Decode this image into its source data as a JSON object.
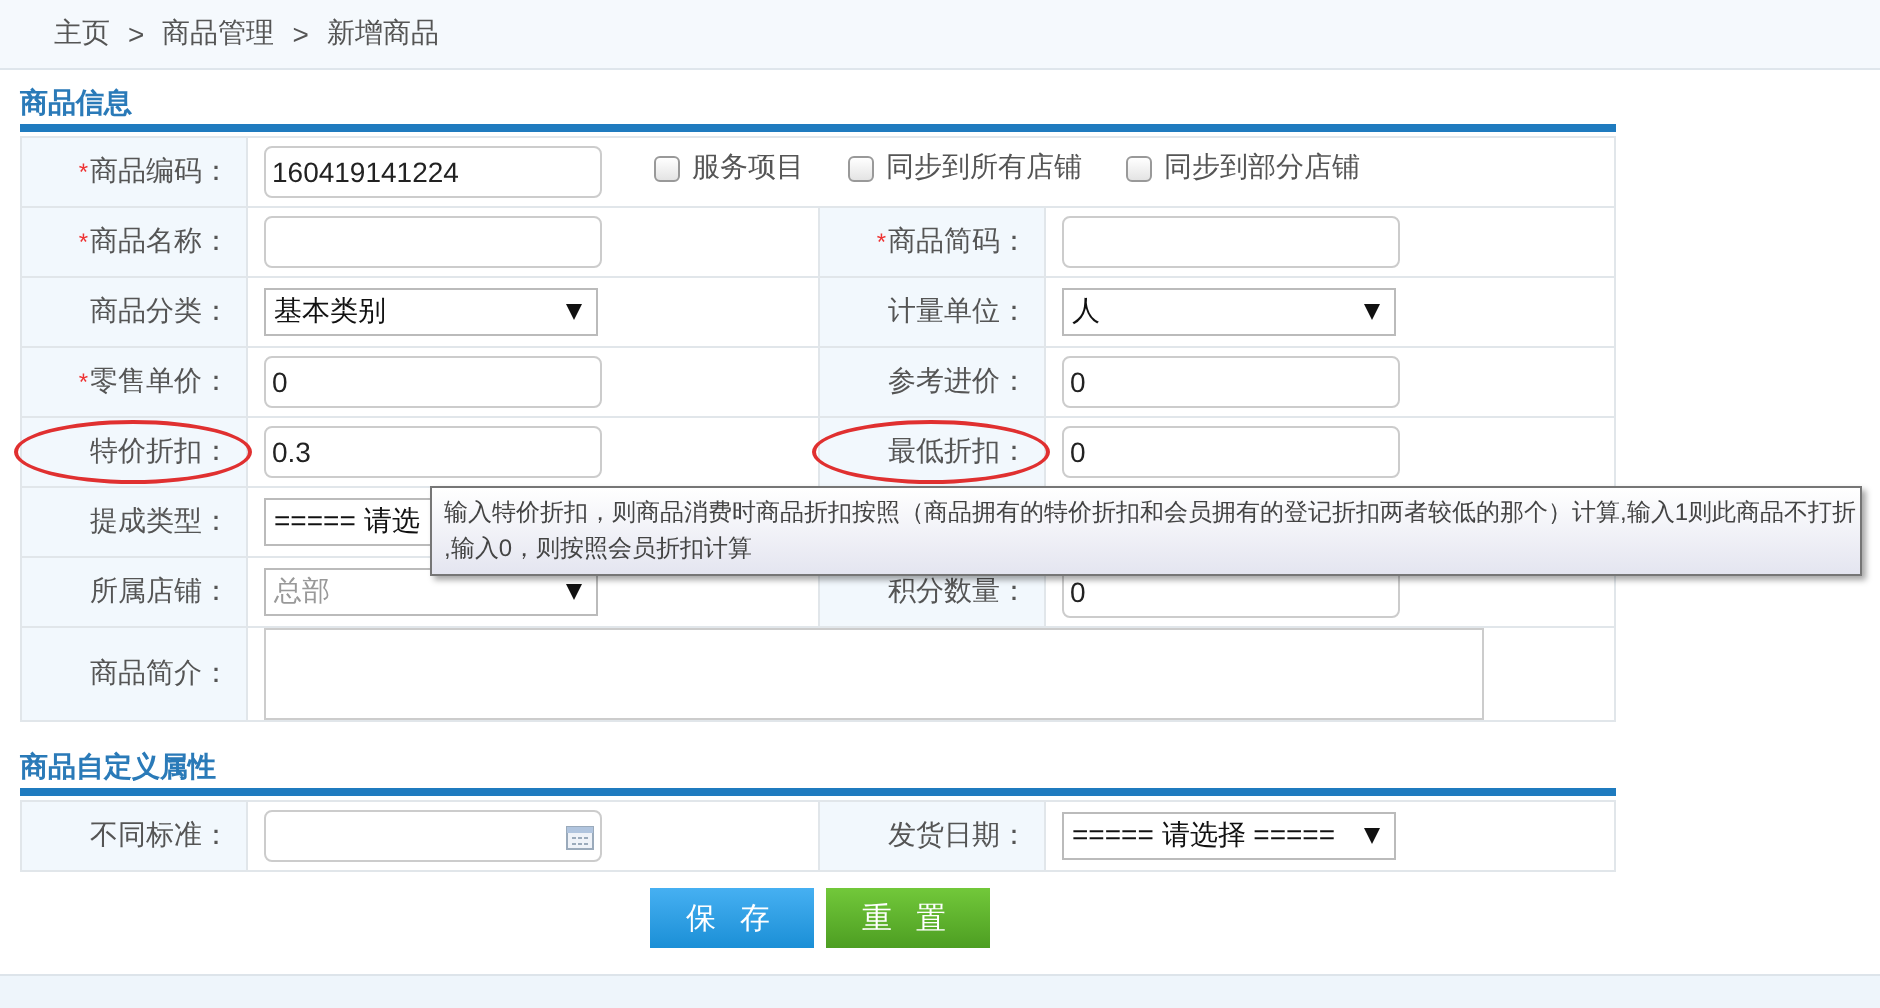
{
  "breadcrumb": {
    "items": [
      "主页",
      "商品管理",
      "新增商品"
    ],
    "separator": ">"
  },
  "sections": [
    {
      "title": "商品信息",
      "rows": [
        {
          "cells": [
            {
              "label": "商品编码：",
              "required_mark": "*",
              "circled": false,
              "kind": "text",
              "value": "160419141224"
            }
          ],
          "checkboxes": [
            {
              "label": "服务项目",
              "checked": false
            },
            {
              "label": "同步到所有店铺",
              "checked": false
            },
            {
              "label": "同步到部分店铺",
              "checked": false
            }
          ]
        },
        {
          "cells": [
            {
              "label": "商品名称：",
              "required_mark": "*",
              "circled": false,
              "kind": "text"
            },
            {
              "label": "商品简码：",
              "required_mark": "*",
              "circled": false,
              "kind": "text"
            }
          ]
        },
        {
          "cells": [
            {
              "label": "商品分类：",
              "circled": false,
              "kind": "select",
              "value": "基本类别",
              "disabled": false
            },
            {
              "label": "计量单位：",
              "circled": false,
              "kind": "select",
              "value": "人",
              "disabled": false
            }
          ]
        },
        {
          "cells": [
            {
              "label": "零售单价：",
              "required_mark": "*",
              "circled": false,
              "kind": "text",
              "value": "0"
            },
            {
              "label": "参考进价：",
              "circled": false,
              "kind": "text",
              "value": "0"
            }
          ]
        },
        {
          "cells": [
            {
              "label": "特价折扣：",
              "circled": true,
              "kind": "text",
              "value": "0.3"
            },
            {
              "label": "最低折扣：",
              "circled": true,
              "kind": "text",
              "value": "0"
            }
          ]
        },
        {
          "cells": [
            {
              "label": "提成类型：",
              "circled": false,
              "kind": "select",
              "value": "===== 请选",
              "disabled": false
            }
          ]
        },
        {
          "cells": [
            {
              "label": "所属店铺：",
              "circled": false,
              "kind": "select",
              "value": "总部",
              "disabled": true
            },
            {
              "label": "积分数量：",
              "circled": false,
              "kind": "text",
              "value": "0"
            }
          ]
        },
        {
          "cells": [
            {
              "label": "商品简介：",
              "circled": false,
              "kind": "textarea"
            }
          ]
        }
      ]
    },
    {
      "title": "商品自定义属性",
      "rows": [
        {
          "cells": [
            {
              "label": "不同标准：",
              "circled": false,
              "kind": "date"
            },
            {
              "label": "发货日期：",
              "circled": false,
              "kind": "select",
              "value": "===== 请选择 =====",
              "disabled": false
            }
          ]
        }
      ]
    }
  ],
  "tooltip": {
    "lines": [
      "输入特价折扣，则商品消费时商品折扣按照（商品拥有的特价折扣和会员拥有的登记折扣两者较低的那个）计算,输入1则此商品不打折",
      ",输入0，则按照会员折扣计算"
    ]
  },
  "buttons": [
    {
      "label": "保 存",
      "kind": "save"
    },
    {
      "label": "重 置",
      "kind": "reset"
    }
  ]
}
